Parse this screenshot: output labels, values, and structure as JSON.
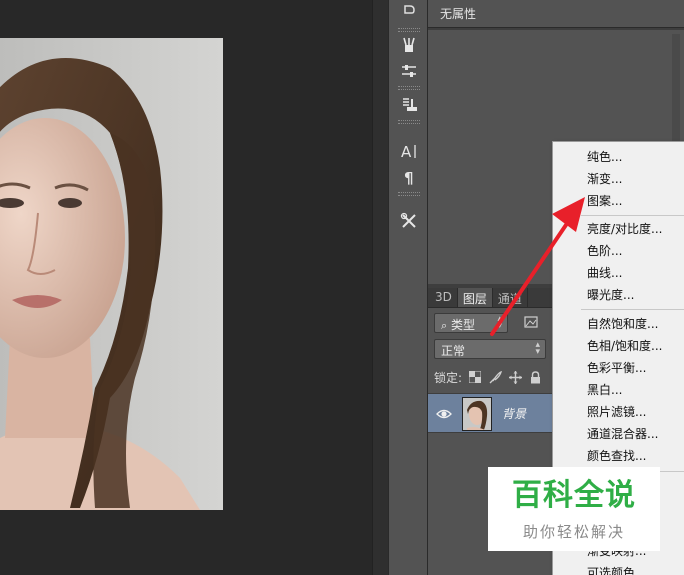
{
  "properties_panel": {
    "title": "无属性"
  },
  "layers_panel": {
    "tabs": [
      {
        "label": "3D",
        "active": false
      },
      {
        "label": "图层",
        "active": true
      },
      {
        "label": "通道",
        "active": false
      }
    ],
    "filter": {
      "icon": "search-icon",
      "label": "类型"
    },
    "blend_mode": "正常",
    "lock_label": "锁定:",
    "layers": [
      {
        "name": "背景",
        "visible": true,
        "selected": true
      }
    ]
  },
  "context_menu": {
    "groups": [
      [
        "纯色...",
        "渐变...",
        "图案..."
      ],
      [
        "亮度/对比度...",
        "色阶...",
        "曲线...",
        "曝光度..."
      ],
      [
        "自然饱和度...",
        "色相/饱和度...",
        "色彩平衡...",
        "黑白...",
        "照片滤镜...",
        "通道混合器...",
        "颜色查找..."
      ],
      [
        "渐变映射...",
        "可选颜色..."
      ]
    ]
  },
  "watermark": {
    "main": "百科全说",
    "sub": "助你轻松解决"
  },
  "colors": {
    "panel_bg": "#535353",
    "selected_layer": "#6d819d",
    "menu_bg": "#f0f0f0",
    "arrow": "#e8202a",
    "watermark_green": "#2fae46"
  },
  "tools": [
    "brush-icon",
    "adjust-sliders-icon",
    "stamp-icon",
    "type-icon",
    "paragraph-icon",
    "tools-icon"
  ]
}
